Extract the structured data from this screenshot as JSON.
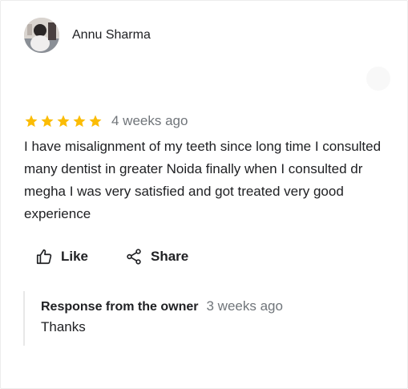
{
  "review": {
    "reviewer_name": "Annu Sharma",
    "rating": 5,
    "max_rating": 5,
    "date": "4 weeks ago",
    "text": "I have misalignment of my teeth since long time I consulted many dentist in greater Noida finally when I consulted dr megha I was very satisfied and got treated very good experience"
  },
  "actions": {
    "like_label": "Like",
    "share_label": "Share"
  },
  "owner_response": {
    "title": "Response from the owner",
    "date": "3 weeks ago",
    "text": "Thanks"
  },
  "colors": {
    "star": "#fbbc04",
    "secondary_text": "#70757a",
    "primary_text": "#202124"
  },
  "icons": [
    "avatar-photo",
    "star-icon",
    "thumb-up-icon",
    "share-icon",
    "more-options-icon"
  ]
}
